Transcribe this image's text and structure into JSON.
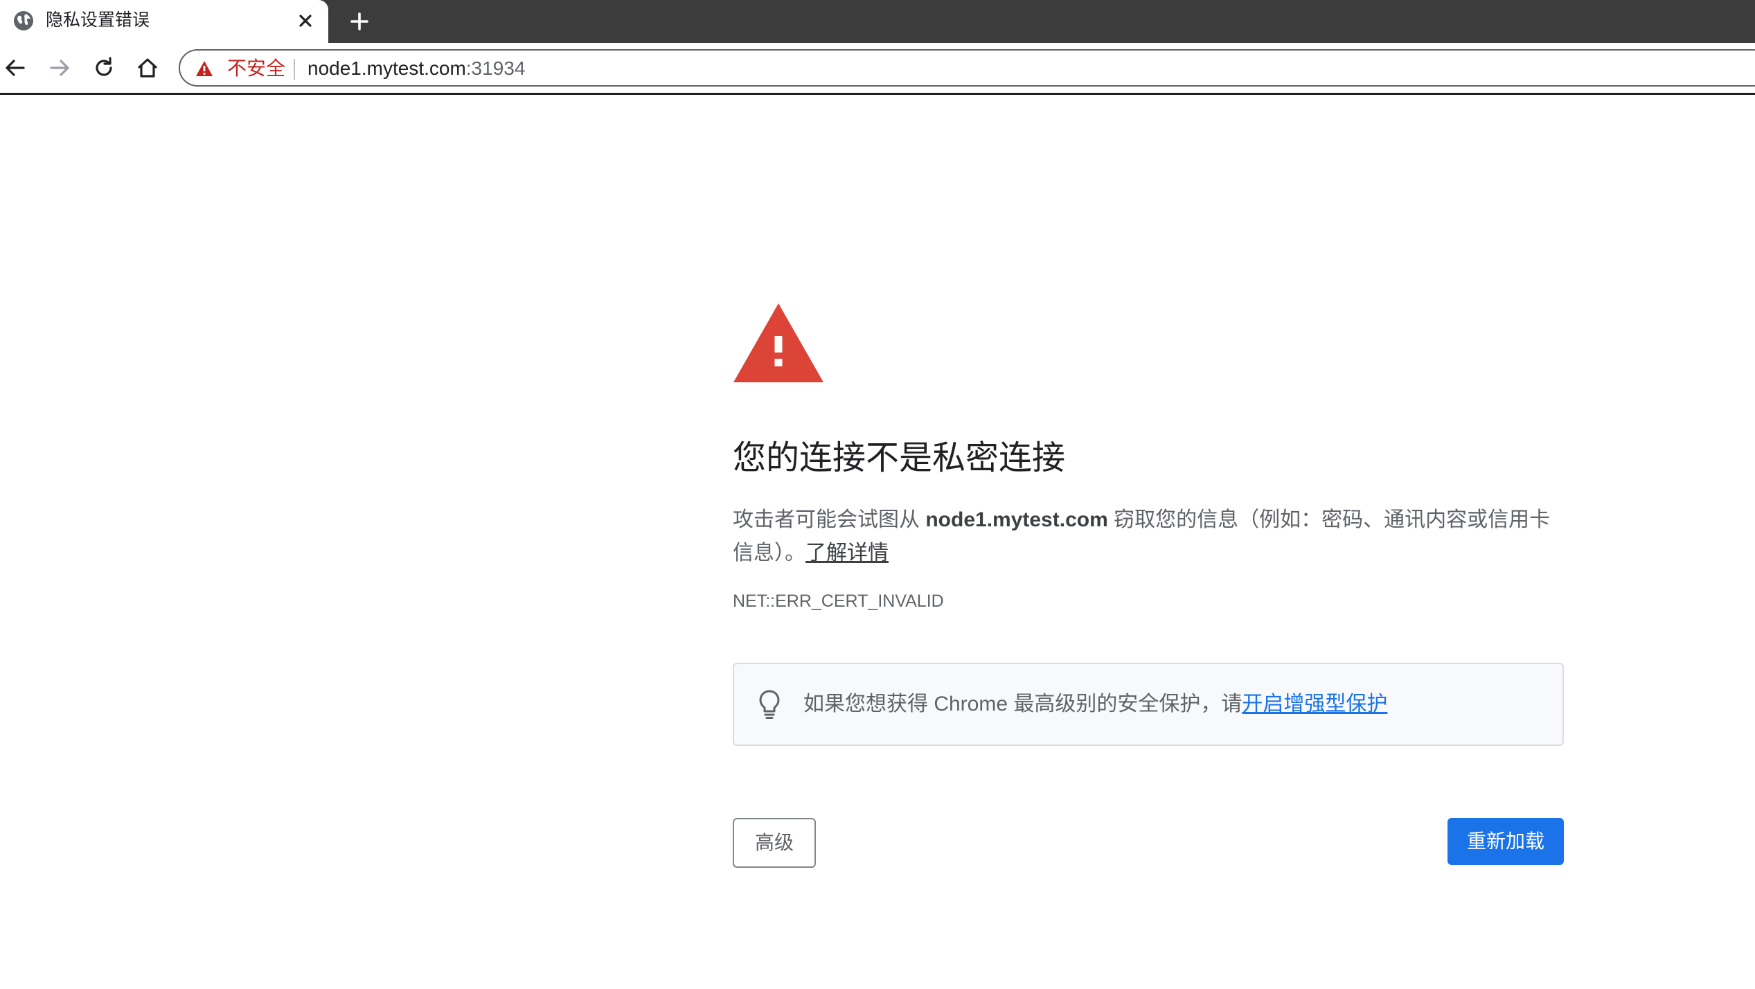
{
  "tab": {
    "title": "隐私设置错误",
    "favicon": "globe-icon",
    "close_icon": "close-icon"
  },
  "toolbar": {
    "back_icon": "arrow-left-icon",
    "forward_icon": "arrow-right-icon",
    "reload_icon": "reload-icon",
    "home_icon": "home-icon",
    "security_label": "不安全",
    "url_host": "node1.mytest.com",
    "url_port": ":31934"
  },
  "interstitial": {
    "heading": "您的连接不是私密连接",
    "message_prefix": "攻击者可能会试图从 ",
    "message_host": "node1.mytest.com",
    "message_suffix": " 窃取您的信息（例如：密码、通讯内容或信用卡信息）。",
    "learn_more": "了解详情",
    "error_code": "NET::ERR_CERT_INVALID",
    "enhanced_protection_text": "如果您想获得 Chrome 最高级别的安全保护，请",
    "enhanced_protection_link": "开启增强型保护",
    "advanced_button": "高级",
    "reload_button": "重新加载"
  },
  "colors": {
    "warning_red": "#db4437",
    "insecure_text": "#c5221f",
    "primary_blue": "#1a73e8",
    "tabstrip_bg": "#3c3c3c"
  }
}
